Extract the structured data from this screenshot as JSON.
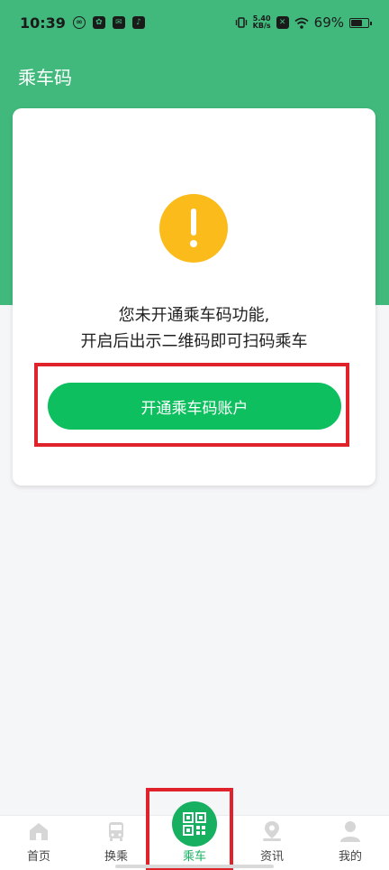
{
  "status_bar": {
    "time": "10:39",
    "net_speed_value": "5.40",
    "net_speed_unit": "KB/s",
    "battery": "69%",
    "battery_level": 0.69
  },
  "header": {
    "title": "乘车码"
  },
  "card": {
    "message_line1": "您未开通乘车码功能,",
    "message_line2": "开启后出示二维码即可扫码乘车",
    "button_label": "开通乘车码账户"
  },
  "tabbar": {
    "tabs": [
      {
        "label": "首页",
        "icon": "home-icon"
      },
      {
        "label": "换乘",
        "icon": "bus-icon"
      },
      {
        "label": "乘车",
        "icon": "qr-code-icon",
        "active": true
      },
      {
        "label": "资讯",
        "icon": "person-pin-icon"
      },
      {
        "label": "我的",
        "icon": "user-icon"
      }
    ]
  },
  "colors": {
    "header_green": "#41b97c",
    "button_green": "#0ebf5f",
    "warning_yellow": "#fbbc1b",
    "highlight_red": "#e0232b"
  }
}
